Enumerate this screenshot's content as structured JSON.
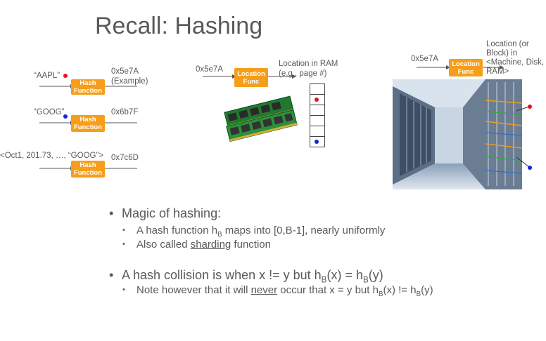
{
  "title": "Recall: Hashing",
  "hash_left": {
    "rows": [
      {
        "input": "“AAPL”",
        "output": "0x5e7A",
        "output_note": "(Example)",
        "box_label": "Hash Function",
        "dot": "red"
      },
      {
        "input": "“GOOG”",
        "output": "0x6b7F",
        "box_label": "Hash Function",
        "dot": "blue"
      },
      {
        "input": "<Oct1, 201.73, …, “GOOG”>",
        "output": "0x7c6D",
        "box_label": "Hash Function"
      }
    ]
  },
  "ram_diagram": {
    "input": "0x5e7A",
    "box_label": "Location Func",
    "location_label": "Location in RAM (e.g., page #)",
    "image_icon": "ram-sticks-image"
  },
  "datacenter_diagram": {
    "input": "0x5e7A",
    "box_label": "Location Func",
    "location_label": "Location (or Block) in <Machine, Disk, RAM>",
    "image_icon": "datacenter-racks-image"
  },
  "colors": {
    "box": "#f59e1b",
    "red_dot": "#e8101c",
    "blue_dot": "#1326d6"
  },
  "bullets": {
    "b1": "Magic of hashing:",
    "b1_sub1": "A hash function h",
    "b1_sub1_sub": "B",
    "b1_sub1_rest": " maps into [0,B-1], nearly uniformly",
    "b1_sub2_pre": "Also called ",
    "b1_sub2_u": "sharding",
    "b1_sub2_post": " function",
    "b2_pre": "A hash collision is when x != y but h",
    "b2_s1": "B",
    "b2_mid": "(x) = h",
    "b2_s2": "B",
    "b2_post": "(y)",
    "b2_sub_pre": "Note however that it will ",
    "b2_sub_u": "never",
    "b2_sub_mid": " occur that x = y but h",
    "b2_sub_s1": "B",
    "b2_sub_mid2": "(x) != h",
    "b2_sub_s2": "B",
    "b2_sub_post": "(y)"
  }
}
